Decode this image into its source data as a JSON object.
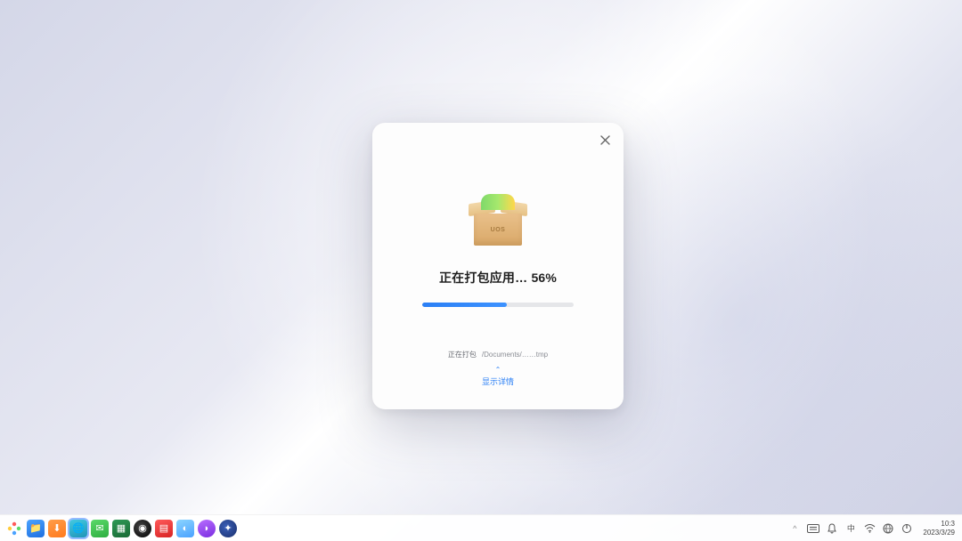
{
  "dialog": {
    "box_label": "UOS",
    "progress_prefix": "正在打包应用…",
    "progress_percent": 56,
    "progress_percent_display": "56%",
    "status_label": "正在打包",
    "status_path": "/Documents/……tmp",
    "show_details": "显示详情"
  },
  "taskbar": {
    "apps": [
      {
        "name": "launcher",
        "label": ""
      },
      {
        "name": "file-manager",
        "label": ""
      },
      {
        "name": "app-store",
        "label": ""
      },
      {
        "name": "browser",
        "label": ""
      },
      {
        "name": "mail",
        "label": ""
      },
      {
        "name": "calendar",
        "label": ""
      },
      {
        "name": "music",
        "label": ""
      },
      {
        "name": "image-viewer",
        "label": ""
      },
      {
        "name": "settings",
        "label": ""
      },
      {
        "name": "moon-app",
        "label": ""
      },
      {
        "name": "disc-app",
        "label": ""
      }
    ]
  },
  "tray": {
    "time": "10:3",
    "date": "2023/3/29"
  }
}
